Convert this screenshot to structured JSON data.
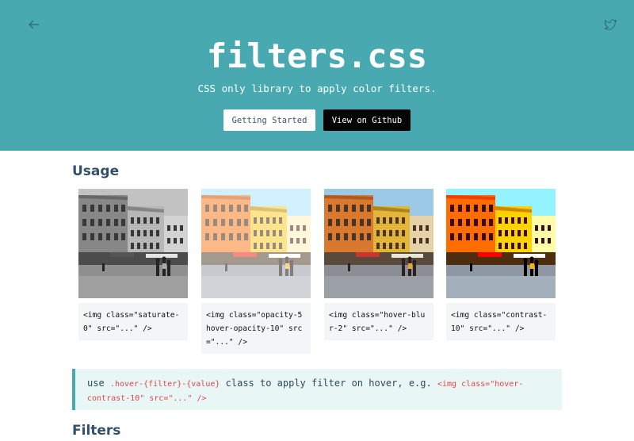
{
  "hero": {
    "title": "filters.css",
    "subtitle": "CSS only library to apply color filters.",
    "start_button": "Getting Started",
    "github_button": "View on Github",
    "bg_color": "#48aab0"
  },
  "usage": {
    "heading": "Usage",
    "cards": [
      {
        "code": "<img class=\"saturate-0\" src=\"...\" />"
      },
      {
        "code": "<img class=\"opacity-5 hover-opacity-10\" src=\"...\" />"
      },
      {
        "code": "<img class=\"hover-blur-2\" src=\"...\" />"
      },
      {
        "code": "<img class=\"contrast-10\" src=\"...\" />"
      }
    ]
  },
  "note": {
    "prefix": "use",
    "class_code": ".hover-{filter}-{value}",
    "middle": "class to apply filter on hover, e.g.",
    "example_code": "<img class=\"hover-contrast-10\" src=\"...\" />"
  },
  "filters": {
    "heading": "Filters"
  },
  "icons": {
    "back": "arrow-left-icon",
    "twitter": "twitter-icon"
  }
}
